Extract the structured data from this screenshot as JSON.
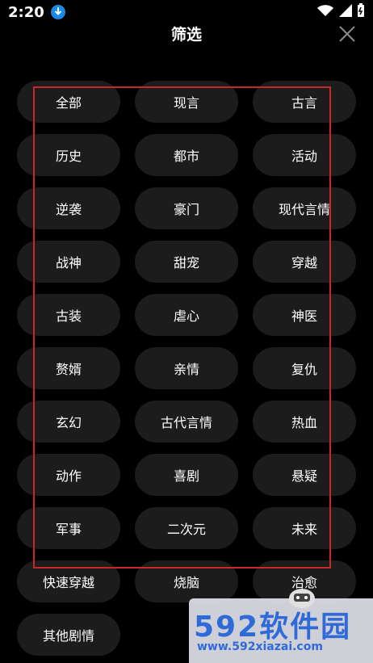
{
  "status_bar": {
    "time": "2:20",
    "icons": [
      "download-badge",
      "wifi-icon",
      "signal-icon",
      "battery-icon"
    ]
  },
  "header": {
    "title": "筛选",
    "close_icon": "close-icon"
  },
  "filters": [
    "全部",
    "现言",
    "古言",
    "历史",
    "都市",
    "活动",
    "逆袭",
    "豪门",
    "现代言情",
    "战神",
    "甜宠",
    "穿越",
    "古装",
    "虐心",
    "神医",
    "赘婿",
    "亲情",
    "复仇",
    "玄幻",
    "古代言情",
    "热血",
    "动作",
    "喜剧",
    "悬疑",
    "军事",
    "二次元",
    "未来",
    "快速穿越",
    "烧脑",
    "治愈",
    "其他剧情"
  ],
  "colors": {
    "background": "#000000",
    "chip": "#1c1c1c",
    "overlay_border": "#c62828",
    "badge": "#1e88e5"
  },
  "watermark": {
    "big": "592软件园",
    "small": "www.592xiazai.com"
  }
}
